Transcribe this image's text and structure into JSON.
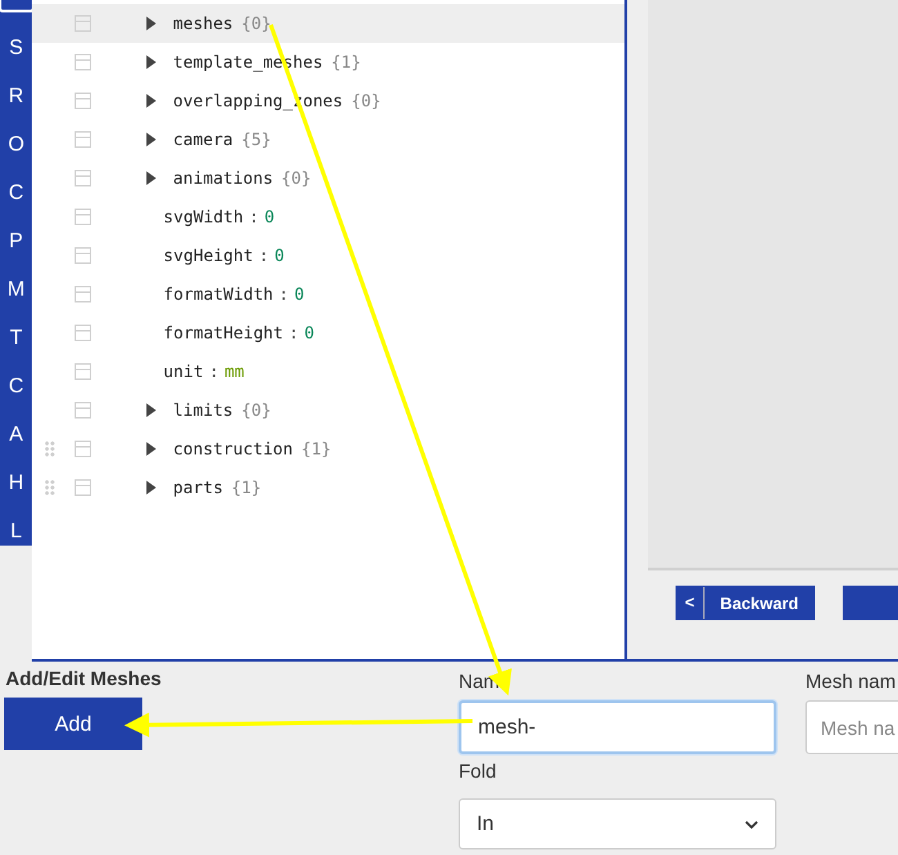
{
  "sidebar": {
    "items": [
      {
        "label": "S"
      },
      {
        "label": "R"
      },
      {
        "label": "O"
      },
      {
        "label": "C"
      },
      {
        "label": "P"
      },
      {
        "label": "M"
      },
      {
        "label": "T"
      },
      {
        "label": "C"
      },
      {
        "label": "A"
      },
      {
        "label": "H"
      },
      {
        "label": "L"
      }
    ]
  },
  "tree": {
    "rows": [
      {
        "kind": "object",
        "key": "meshes",
        "count": "{0}",
        "selected": true,
        "draggable": false
      },
      {
        "kind": "object",
        "key": "template_meshes",
        "count": "{1}",
        "selected": false,
        "draggable": false
      },
      {
        "kind": "object",
        "key": "overlapping_zones",
        "count": "{0}",
        "selected": false,
        "draggable": false
      },
      {
        "kind": "object",
        "key": "camera",
        "count": "{5}",
        "selected": false,
        "draggable": false
      },
      {
        "kind": "object",
        "key": "animations",
        "count": "{0}",
        "selected": false,
        "draggable": false
      },
      {
        "kind": "number",
        "key": "svgWidth",
        "separator": ":",
        "value": "0",
        "selected": false,
        "draggable": false
      },
      {
        "kind": "number",
        "key": "svgHeight",
        "separator": ":",
        "value": "0",
        "selected": false,
        "draggable": false
      },
      {
        "kind": "number",
        "key": "formatWidth",
        "separator": ":",
        "value": "0",
        "selected": false,
        "draggable": false
      },
      {
        "kind": "number",
        "key": "formatHeight",
        "separator": ":",
        "value": "0",
        "selected": false,
        "draggable": false
      },
      {
        "kind": "string",
        "key": "unit",
        "separator": ":",
        "value": "mm",
        "selected": false,
        "draggable": false
      },
      {
        "kind": "object",
        "key": "limits",
        "count": "{0}",
        "selected": false,
        "draggable": false
      },
      {
        "kind": "object",
        "key": "construction",
        "count": "{1}",
        "selected": false,
        "draggable": true
      },
      {
        "kind": "object",
        "key": "parts",
        "count": "{1}",
        "selected": false,
        "draggable": true
      }
    ]
  },
  "navigation": {
    "buttons": [
      {
        "kind": "back",
        "icon_text": "<",
        "label": "Backward"
      },
      {
        "kind": "blank"
      }
    ]
  },
  "form": {
    "title": "Add/Edit Meshes",
    "add_button": "Add",
    "name_field": {
      "label": "Nam",
      "value": "mesh-",
      "focused": true
    },
    "fold_field": {
      "label": "Fold",
      "value": "In"
    },
    "mesh_name_field": {
      "label": "Mesh nam",
      "placeholder": "Mesh na"
    }
  }
}
